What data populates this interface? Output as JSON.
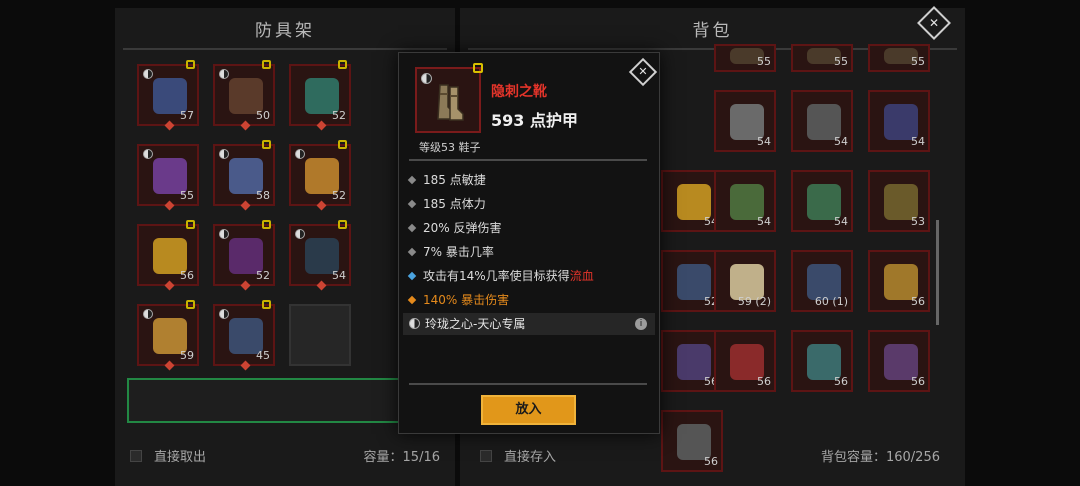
{
  "left_panel": {
    "title": "防具架",
    "footer_checkbox_label": "直接取出",
    "capacity_label": "容量：15/16",
    "items": [
      {
        "level": "57",
        "color": "#3a4a7a",
        "locked": true,
        "set": true
      },
      {
        "level": "50",
        "color": "#5a3a2a",
        "locked": true,
        "set": true
      },
      {
        "level": "52",
        "color": "#2f6b5e",
        "locked": true,
        "set": false
      },
      {
        "level": "55",
        "color": "#6a3a8a",
        "locked": false,
        "set": true
      },
      {
        "level": "58",
        "color": "#4a5a8a",
        "locked": true,
        "set": true
      },
      {
        "level": "52",
        "color": "#b0792a",
        "locked": true,
        "set": true
      },
      {
        "level": "56",
        "color": "#b88a20",
        "locked": true,
        "set": false
      },
      {
        "level": "52",
        "color": "#5a2a6a",
        "locked": true,
        "set": true
      },
      {
        "level": "54",
        "color": "#2a3a4a",
        "locked": true,
        "set": true
      },
      {
        "level": "59",
        "color": "#b08030",
        "locked": true,
        "set": true
      },
      {
        "level": "45",
        "color": "#3a4a6a",
        "locked": true,
        "set": true
      }
    ]
  },
  "right_panel": {
    "title": "背包",
    "footer_checkbox_label": "直接存入",
    "capacity_label": "背包容量：160/256",
    "items": [
      {
        "level": "55",
        "color": "#4a3a2a"
      },
      {
        "level": "55",
        "color": "#4a3a2a"
      },
      {
        "level": "55",
        "color": "#4a3a2a"
      },
      {
        "level": "54",
        "color": "#6a6a6a"
      },
      {
        "level": "54",
        "color": "#555"
      },
      {
        "level": "54",
        "color": "#3a3a6a"
      },
      {
        "level": "54",
        "color": "#b88a20"
      },
      {
        "level": "54",
        "color": "#4a6a3a"
      },
      {
        "level": "54",
        "color": "#3a6a4a"
      },
      {
        "level": "53",
        "color": "#6a5a2a"
      },
      {
        "level": "52",
        "color": "#3a4a6a"
      },
      {
        "level": "59 (2)",
        "color": "#c0b08a"
      },
      {
        "level": "60 (1)",
        "color": "#3a4a6a"
      },
      {
        "level": "56",
        "color": "#a0782a"
      },
      {
        "level": "56",
        "color": "#4a3a6a"
      },
      {
        "level": "56",
        "color": "#8a2a2a"
      },
      {
        "level": "56",
        "color": "#3a6a6a"
      },
      {
        "level": "56",
        "color": "#5a3a6a"
      },
      {
        "level": "56",
        "color": "#555"
      }
    ]
  },
  "tooltip": {
    "item_name": "隐刺之靴",
    "armor": "593 点护甲",
    "level_type": "等级53 鞋子",
    "stats": [
      "185 点敏捷",
      "185 点体力",
      "20% 反弹伤害",
      "7% 暴击几率"
    ],
    "proc_text": "攻击有14%几率使目标获得",
    "proc_effect": "流血",
    "crit_damage": "140% 暴击伤害",
    "set_name": "玲珑之心-天心专属",
    "info_glyph": "i",
    "place_button": "放入",
    "close_glyph": "✕"
  },
  "colors": {
    "name_red": "#e3342a",
    "crit_orange": "#e58a1c",
    "button_gold": "#e1971a"
  }
}
